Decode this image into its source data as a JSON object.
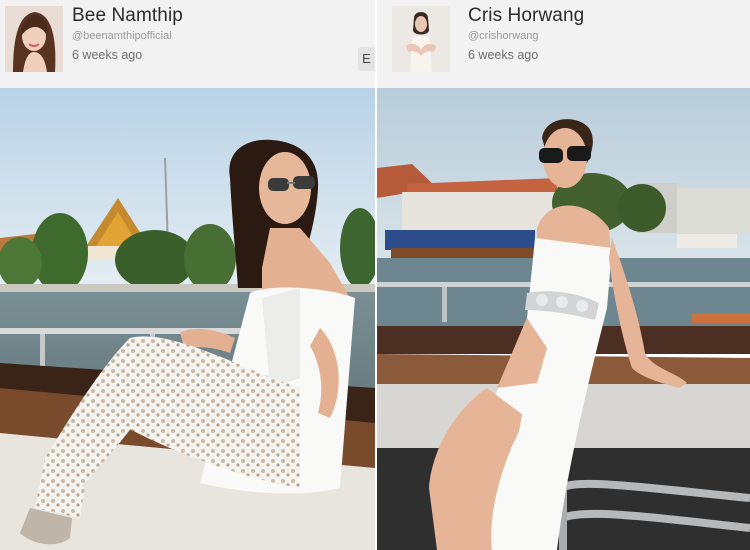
{
  "posts": [
    {
      "author_name": "Bee Namthip",
      "handle": "@beenamthipofficial",
      "time_ago": "6 weeks ago",
      "action_button_label": "E"
    },
    {
      "author_name": "Cris Horwang",
      "handle": "@crishorwang",
      "time_ago": "6 weeks ago"
    }
  ],
  "colors": {
    "header_bg": "#f2f2f2",
    "name_text": "#2b2b2b",
    "handle_text": "#9a9a9a",
    "time_text": "#6e6e6e"
  }
}
